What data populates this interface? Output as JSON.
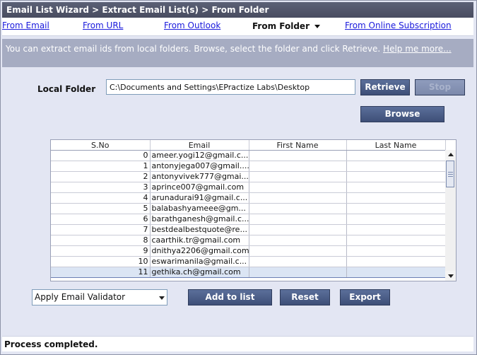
{
  "window": {
    "title": "Email List Wizard > Extract Email List(s) > From Folder"
  },
  "nav": {
    "from_email": "From Email",
    "from_url": "From URL",
    "from_outlook": "From Outlook",
    "from_folder": "From Folder",
    "from_online": "From Online Subscription"
  },
  "info": {
    "text": "You can extract email ids from local folders. Browse, select the folder and click Retrieve.",
    "help": "Help me more..."
  },
  "folder": {
    "label": "Local Folder",
    "path": "C:\\Documents and Settings\\EPractize Labs\\Desktop",
    "retrieve": "Retrieve",
    "stop": "Stop",
    "browse": "Browse"
  },
  "grid": {
    "headers": [
      "S.No",
      "Email",
      "First Name",
      "Last Name"
    ],
    "rows": [
      {
        "sno": "0",
        "email": "ameer.yogi12@gmail.c...",
        "first": "",
        "last": ""
      },
      {
        "sno": "1",
        "email": "antonyjega007@gmail....",
        "first": "",
        "last": ""
      },
      {
        "sno": "2",
        "email": "antonyvivek777@gmai...",
        "first": "",
        "last": ""
      },
      {
        "sno": "3",
        "email": "aprince007@gmail.com",
        "first": "",
        "last": ""
      },
      {
        "sno": "4",
        "email": "arunadurai91@gmail.c...",
        "first": "",
        "last": ""
      },
      {
        "sno": "5",
        "email": "balabashyameee@gm...",
        "first": "",
        "last": ""
      },
      {
        "sno": "6",
        "email": "barathganesh@gmail.c...",
        "first": "",
        "last": ""
      },
      {
        "sno": "7",
        "email": "bestdealbestquote@re...",
        "first": "",
        "last": ""
      },
      {
        "sno": "8",
        "email": "caarthik.tr@gmail.com",
        "first": "",
        "last": ""
      },
      {
        "sno": "9",
        "email": "dnithya2206@gmail.com",
        "first": "",
        "last": ""
      },
      {
        "sno": "10",
        "email": "eswarimanila@gmail.c...",
        "first": "",
        "last": ""
      },
      {
        "sno": "11",
        "email": "gethika.ch@gmail.com",
        "first": "",
        "last": ""
      }
    ],
    "selected_index": 11
  },
  "actions": {
    "validator": "Apply Email Validator",
    "add_to_list": "Add to list",
    "reset": "Reset",
    "export": "Export"
  },
  "status": {
    "text": "Process completed."
  }
}
